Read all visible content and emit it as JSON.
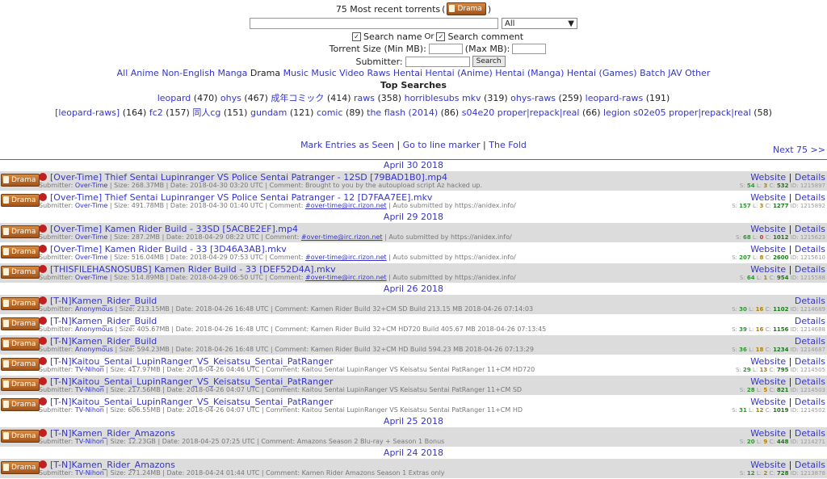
{
  "header": {
    "title": "75 Most recent torrents",
    "title_badge": "Drama",
    "category_select": "All",
    "search_name_label": "Search name",
    "or_label": "Or",
    "search_comment_label": "Search comment",
    "size_label": "Torrent Size (Min MB):",
    "max_label": "(Max MB):",
    "submitter_label": "Submitter:",
    "search_button": "Search"
  },
  "categories": [
    "All Anime",
    "Non-English",
    "Manga",
    "Drama",
    "Music",
    "Music Video",
    "Raws",
    "Hentai",
    "Hentai (Anime)",
    "Hentai (Manga)",
    "Hentai (Games)",
    "Batch",
    "JAV",
    "Other"
  ],
  "top_searches": {
    "title": "Top Searches",
    "line1": [
      {
        "term": "leopard",
        "count": "(470)"
      },
      {
        "term": "ohys",
        "count": "(467)"
      },
      {
        "term": "成年コミック",
        "count": "(414)"
      },
      {
        "term": "raws",
        "count": "(358)"
      },
      {
        "term": "horriblesubs mkv",
        "count": "(319)"
      },
      {
        "term": "ohys-raws",
        "count": "(259)"
      },
      {
        "term": "leopard-raws",
        "count": "(191)"
      }
    ],
    "line2": [
      {
        "term": "[leopard-raws]",
        "count": "(164)"
      },
      {
        "term": "fc2",
        "count": "(157)"
      },
      {
        "term": "同人cg",
        "count": "(151)"
      },
      {
        "term": "gundam",
        "count": "(121)"
      },
      {
        "term": "comic",
        "count": "(89)"
      },
      {
        "term": "the flash (2014)",
        "count": "(86)"
      },
      {
        "term": "s04e20 proper|repack|real",
        "count": "(66)"
      },
      {
        "term": "legion s02e05 proper|repack|real",
        "count": "(58)"
      }
    ]
  },
  "nav": {
    "mark": "Mark Entries as Seen",
    "goto": "Go to line marker",
    "fold": "The Fold",
    "next": "Next 75 >>"
  },
  "labels": {
    "submitter": "Submitter:",
    "size": "Size:",
    "date": "Date:",
    "comment": "Comment:",
    "website": "Website",
    "details": "Details",
    "sep": "|",
    "badge": "Drama"
  },
  "groups": [
    {
      "date": "April 30 2018",
      "entries": [
        {
          "title": "[Over-Time] Thief Sentai Lupinranger VS Police Sentai Patranger - 12SD [79BAD1B0].mp4",
          "submitter": "Over-Time",
          "size": "268.37MB",
          "date": "2018-04-30 03:20 UTC",
          "comment_link": "",
          "comment": "Brought to you by the autoupload script Az hacked up.",
          "website": true,
          "s": "54",
          "l": "3",
          "c": "532",
          "id": "1215897"
        },
        {
          "title": "[Over-Time] Thief Sentai Lupinranger VS Police Sentai Patranger - 12 [D7FAA7EE].mkv",
          "submitter": "Over-Time",
          "size": "491.78MB",
          "date": "2018-04-30 01:40 UTC",
          "comment_link": "#over-time@irc.rizon.net",
          "comment": "| Auto submitted by https://anidex.info/",
          "website": true,
          "s": "157",
          "l": "3",
          "c": "1277",
          "id": "1215892"
        }
      ]
    },
    {
      "date": "April 29 2018",
      "entries": [
        {
          "title": "[Over-Time] Kamen Rider Build - 33SD [5ACBE2EF].mp4",
          "submitter": "Over-Time",
          "size": "287.2MB",
          "date": "2018-04-29 08:22 UTC",
          "comment_link": "#over-time@irc.rizon.net",
          "comment": "| Auto submitted by https://anidex.info/",
          "website": true,
          "s": "68",
          "l": "0",
          "c": "1012",
          "id": "1215623"
        },
        {
          "title": "[Over-Time] Kamen Rider Build - 33 [3D46A3AB].mkv",
          "submitter": "Over-Time",
          "size": "516.04MB",
          "date": "2018-04-29 07:53 UTC",
          "comment_link": "#over-time@irc.rizon.net",
          "comment": "| Auto submitted by https://anidex.info/",
          "website": true,
          "s": "207",
          "l": "8",
          "c": "2600",
          "id": "1215610"
        },
        {
          "title": "[THISFILEHASNOSUBS] Kamen Rider Build - 33 [DEF52D4A].mkv",
          "submitter": "Over-Time",
          "size": "514.89MB",
          "date": "2018-04-29 06:50 UTC",
          "comment_link": "#over-time@irc.rizon.net",
          "comment": "| Auto submitted by https://anidex.info/",
          "website": true,
          "s": "64",
          "l": "1",
          "c": "954",
          "id": "1215588"
        }
      ]
    },
    {
      "date": "April 26 2018",
      "entries": [
        {
          "title": "[T-N]Kamen_Rider_Build",
          "submitter": "Anonymous",
          "size": "213.15MB",
          "date": "2018-04-26 16:48 UTC",
          "comment_link": "",
          "comment": "Kamen Rider Build 32+CM SD Build 213.15 MB 2018-04-26 07:14:03",
          "website": false,
          "s": "30",
          "l": "16",
          "c": "1102",
          "id": "1214689"
        },
        {
          "title": "[T-N]Kamen_Rider_Build",
          "submitter": "Anonymous",
          "size": "405.67MB",
          "date": "2018-04-26 16:48 UTC",
          "comment_link": "",
          "comment": "Kamen Rider Build 32+CM HD720 Build 405.67 MB 2018-04-26 07:13:45",
          "website": false,
          "s": "39",
          "l": "16",
          "c": "1156",
          "id": "1214688"
        },
        {
          "title": "[T-N]Kamen_Rider_Build",
          "submitter": "Anonymous",
          "size": "594.23MB",
          "date": "2018-04-26 16:48 UTC",
          "comment_link": "",
          "comment": "Kamen Rider Build 32+CM HD Build 594.23 MB 2018-04-26 07:13:29",
          "website": false,
          "s": "36",
          "l": "18",
          "c": "1234",
          "id": "1214687"
        },
        {
          "title": "[T-N]Kaitou_Sentai_LupinRanger_VS_Keisatsu_Sentai_PatRanger",
          "submitter": "TV-Nihon",
          "size": "417.97MB",
          "date": "2018-04-26 04:46 UTC",
          "comment_link": "",
          "comment": "Kaitou Sentai LupinRanger VS Keisatsu Sentai PatRanger 11+CM HD720",
          "website": true,
          "s": "29",
          "l": "13",
          "c": "795",
          "id": "1214505"
        },
        {
          "title": "[T-N]Kaitou_Sentai_LupinRanger_VS_Keisatsu_Sentai_PatRanger",
          "submitter": "TV-Nihon",
          "size": "217.56MB",
          "date": "2018-04-26 04:07 UTC",
          "comment_link": "",
          "comment": "Kaitou Sentai LupinRanger VS Keisatsu Sentai PatRanger 11+CM SD",
          "website": true,
          "s": "28",
          "l": "5",
          "c": "821",
          "id": "1214503"
        },
        {
          "title": "[T-N]Kaitou_Sentai_LupinRanger_VS_Keisatsu_Sentai_PatRanger",
          "submitter": "TV-Nihon",
          "size": "606.55MB",
          "date": "2018-04-26 04:07 UTC",
          "comment_link": "",
          "comment": "Kaitou Sentai LupinRanger VS Keisatsu Sentai PatRanger 11+CM HD",
          "website": true,
          "s": "31",
          "l": "12",
          "c": "1019",
          "id": "1214502"
        }
      ]
    },
    {
      "date": "April 25 2018",
      "entries": [
        {
          "title": "[T-N]Kamen_Rider_Amazons",
          "submitter": "TV-Nihon",
          "size": "12.23GB",
          "date": "2018-04-25 07:25 UTC",
          "comment_link": "",
          "comment": "Amazons Season 2 Blu-ray + Season 1 Bonus",
          "website": true,
          "s": "20",
          "l": "9",
          "c": "448",
          "id": "1214271"
        }
      ]
    },
    {
      "date": "April 24 2018",
      "entries": [
        {
          "title": "[T-N]Kamen_Rider_Amazons",
          "submitter": "TV-Nihon",
          "size": "271.24MB",
          "date": "2018-04-24 01:44 UTC",
          "comment_link": "",
          "comment": "Kamen Rider Amazons Season 1 Extras only",
          "website": true,
          "s": "12",
          "l": "2",
          "c": "728",
          "id": "1213878"
        }
      ]
    }
  ]
}
